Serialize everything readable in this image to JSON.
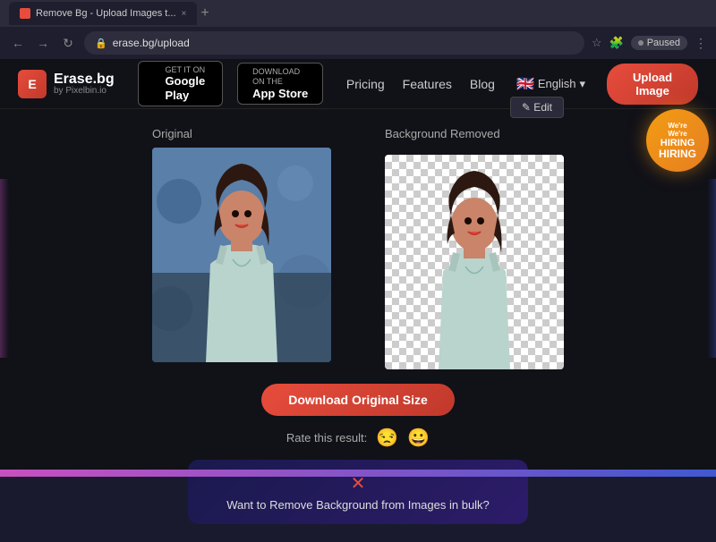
{
  "browser": {
    "tab_title": "Remove Bg - Upload Images t...",
    "tab_close": "×",
    "tab_new": "+",
    "back_btn": "←",
    "forward_btn": "→",
    "reload_btn": "↻",
    "address": "erase.bg/upload",
    "paused_label": "Paused",
    "menu_dots": "⋮"
  },
  "navbar": {
    "logo_name": "Erase.bg",
    "logo_sub": "by Pixelbin.io",
    "google_play_get": "GET IT ON",
    "google_play_name": "Google Play",
    "app_store_get": "Download on the",
    "app_store_name": "App Store",
    "links": [
      {
        "label": "Pricing"
      },
      {
        "label": "Features"
      },
      {
        "label": "Blog"
      }
    ],
    "language": "English",
    "upload_btn": "Upload Image"
  },
  "main": {
    "original_label": "Original",
    "removed_label": "Background Removed",
    "edit_btn": "✎ Edit",
    "download_btn": "Download Original Size",
    "rate_label": "Rate this result:",
    "rate_bad": "😒",
    "rate_good": "😀"
  },
  "bulk_promo": {
    "icon": "✕",
    "text": "Want to Remove Background from Images in bulk?"
  },
  "hiring": {
    "line1": "We're",
    "line2": "HIRING"
  }
}
